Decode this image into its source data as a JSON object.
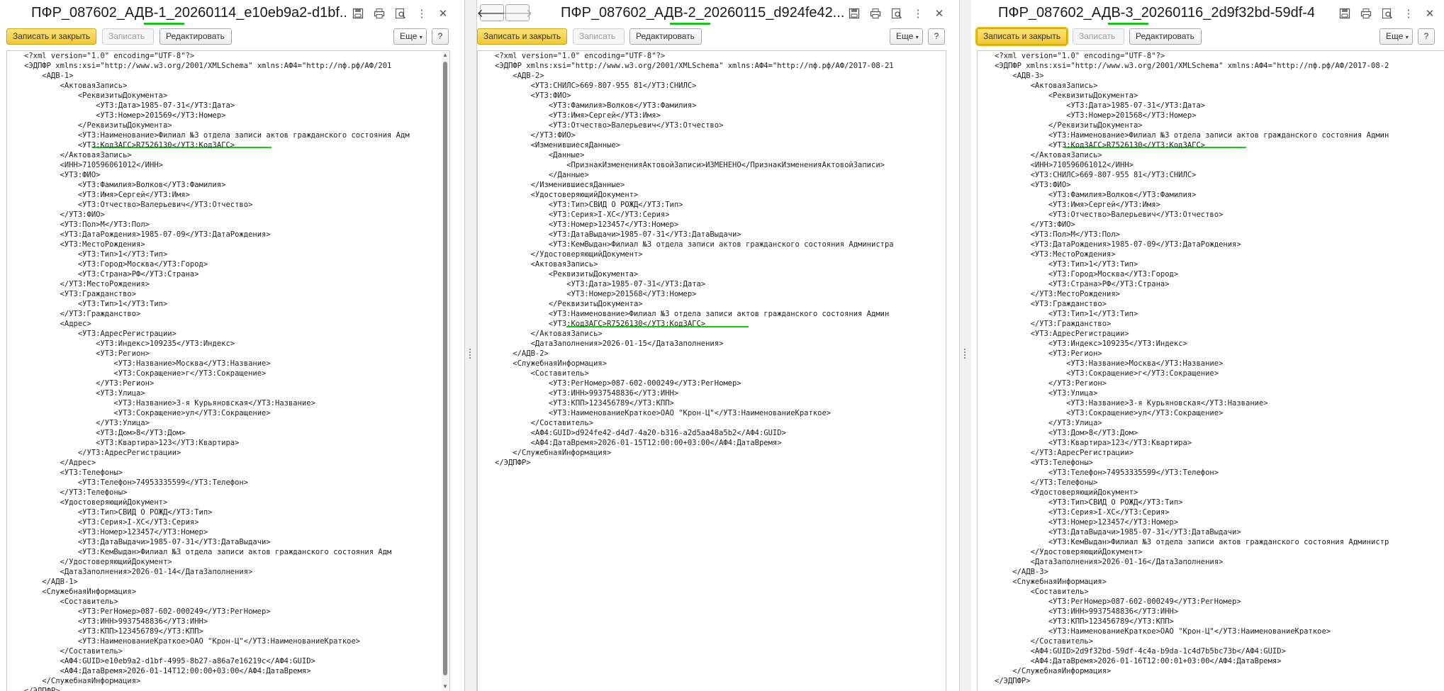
{
  "icons": {
    "save": "save-disk-icon",
    "print": "printer-icon",
    "preview": "preview-icon",
    "more": "more-vertical-icon",
    "close": "close-icon",
    "back": "back-arrow-icon",
    "forward": "forward-arrow-icon"
  },
  "colors": {
    "accent_underline": "#1ec21e",
    "primary_button": "#f2c830"
  },
  "toolbar": {
    "write_close": "Записать и закрыть",
    "write": "Записать",
    "edit": "Редактировать",
    "more": "Еще",
    "help": "?"
  },
  "panels": [
    {
      "title": "ПФР_087602_АДВ-1_20260114_e10eb9a2-d1bf...",
      "lines": [
        "<?xml version=\"1.0\" encoding=\"UTF-8\"?>",
        "<ЭДПФР xmlns:xsi=\"http://www.w3.org/2001/XMLSchema\" xmlns:АФ4=\"http://пф.рф/АФ/201",
        "    <АДВ-1>",
        "        <АктоваяЗапись>",
        "            <РеквизитыДокумента>",
        "                <УТ3:Дата>1985-07-31</УТ3:Дата>",
        "                <УТ3:Номер>201569</УТ3:Номер>",
        "            </РеквизитыДокумента>",
        "            <УТ3:Наименование>Филиал №3 отдела записи актов гражданского состояния Адм",
        "            <УТ3:КодЗАГС>R7526130</УТ3:КодЗАГС>",
        "        </АктоваяЗапись>",
        "        <ИНН>710596061012</ИНН>",
        "        <УТ3:ФИО>",
        "            <УТ3:Фамилия>Волков</УТ3:Фамилия>",
        "            <УТ3:Имя>Сергей</УТ3:Имя>",
        "            <УТ3:Отчество>Валерьевич</УТ3:Отчество>",
        "        </УТ3:ФИО>",
        "        <УТ3:Пол>М</УТ3:Пол>",
        "        <УТ3:ДатаРождения>1985-07-09</УТ3:ДатаРождения>",
        "        <УТ3:МестоРождения>",
        "            <УТ3:Тип>1</УТ3:Тип>",
        "            <УТ3:Город>Москва</УТ3:Город>",
        "            <УТ3:Страна>РФ</УТ3:Страна>",
        "        </УТ3:МестоРождения>",
        "        <УТ3:Гражданство>",
        "            <УТ3:Тип>1</УТ3:Тип>",
        "        </УТ3:Гражданство>",
        "        <Адрес>",
        "            <УТ3:АдресРегистрации>",
        "                <УТ3:Индекс>109235</УТ3:Индекс>",
        "                <УТ3:Регион>",
        "                    <УТ3:Название>Москва</УТ3:Название>",
        "                    <УТ3:Сокращение>г</УТ3:Сокращение>",
        "                </УТ3:Регион>",
        "                <УТ3:Улица>",
        "                    <УТ3:Название>3-я Курьяновская</УТ3:Название>",
        "                    <УТ3:Сокращение>ул</УТ3:Сокращение>",
        "                </УТ3:Улица>",
        "                <УТ3:Дом>8</УТ3:Дом>",
        "                <УТ3:Квартира>123</УТ3:Квартира>",
        "            </УТ3:АдресРегистрации>",
        "        </Адрес>",
        "        <УТ3:Телефоны>",
        "            <УТ3:Телефон>74953335599</УТ3:Телефон>",
        "        </УТ3:Телефоны>",
        "        <УдостоверяющийДокумент>",
        "            <УТ3:Тип>СВИД О РОЖД</УТ3:Тип>",
        "            <УТ3:Серия>I-ХС</УТ3:Серия>",
        "            <УТ3:Номер>123457</УТ3:Номер>",
        "            <УТ3:ДатаВыдачи>1985-07-31</УТ3:ДатаВыдачи>",
        "            <УТ3:КемВыдан>Филиал №3 отдела записи актов гражданского состояния Адм",
        "        </УдостоверяющийДокумент>",
        "        <ДатаЗаполнения>2026-01-14</ДатаЗаполнения>",
        "    </АДВ-1>",
        "    <СлужебнаяИнформация>",
        "        <Составитель>",
        "            <УТ3:РегНомер>087-602-000249</УТ3:РегНомер>",
        "            <УТ3:ИНН>9937548836</УТ3:ИНН>",
        "            <УТ3:КПП>123456789</УТ3:КПП>",
        "            <УТ3:НаименованиеКраткое>ОАО \"Крон-Ц\"</УТ3:НаименованиеКраткое>",
        "        </Составитель>",
        "        <АФ4:GUID>e10eb9a2-d1bf-4995-8b27-a86a7e16219c</АФ4:GUID>",
        "        <АФ4:ДатаВремя>2026-01-14T12:00:00+03:00</АФ4:ДатаВремя>",
        "    </СлужебнаяИнформация>",
        "</ЭДПФР>"
      ]
    },
    {
      "title": "ПФР_087602_АДВ-2_20260115_d924fe42...",
      "lines": [
        "<?xml version=\"1.0\" encoding=\"UTF-8\"?>",
        "<ЭДПФР xmlns:xsi=\"http://www.w3.org/2001/XMLSchema\" xmlns:АФ4=\"http://пф.рф/АФ/2017-08-21",
        "    <АДВ-2>",
        "        <УТ3:СНИЛС>669-807-955 81</УТ3:СНИЛС>",
        "        <УТ3:ФИО>",
        "            <УТ3:Фамилия>Волков</УТ3:Фамилия>",
        "            <УТ3:Имя>Сергей</УТ3:Имя>",
        "            <УТ3:Отчество>Валерьевич</УТ3:Отчество>",
        "        </УТ3:ФИО>",
        "        <ИзменившиесяДанные>",
        "            <Данные>",
        "                <ПризнакИзмененияАктовойЗаписи>ИЗМЕНЕНО</ПризнакИзмененияАктовойЗаписи>",
        "            </Данные>",
        "        </ИзменившиесяДанные>",
        "        <УдостоверяющийДокумент>",
        "            <УТ3:Тип>СВИД О РОЖД</УТ3:Тип>",
        "            <УТ3:Серия>I-ХС</УТ3:Серия>",
        "            <УТ3:Номер>123457</УТ3:Номер>",
        "            <УТ3:ДатаВыдачи>1985-07-31</УТ3:ДатаВыдачи>",
        "            <УТ3:КемВыдан>Филиал №3 отдела записи актов гражданского состояния Администра",
        "        </УдостоверяющийДокумент>",
        "        <АктоваяЗапись>",
        "            <РеквизитыДокумента>",
        "                <УТ3:Дата>1985-07-31</УТ3:Дата>",
        "                <УТ3:Номер>201568</УТ3:Номер>",
        "            </РеквизитыДокумента>",
        "            <УТ3:Наименование>Филиал №3 отдела записи актов гражданского состояния Админ",
        "            <УТ3:КодЗАГС>R7526130</УТ3:КодЗАГС>",
        "        </АктоваяЗапись>",
        "        <ДатаЗаполнения>2026-01-15</ДатаЗаполнения>",
        "    </АДВ-2>",
        "    <СлужебнаяИнформация>",
        "        <Составитель>",
        "            <УТ3:РегНомер>087-602-000249</УТ3:РегНомер>",
        "            <УТ3:ИНН>9937548836</УТ3:ИНН>",
        "            <УТ3:КПП>123456789</УТ3:КПП>",
        "            <УТ3:НаименованиеКраткое>ОАО \"Крон-Ц\"</УТ3:НаименованиеКраткое>",
        "        </Составитель>",
        "        <АФ4:GUID>d924fe42-d4d7-4a20-b316-a2d5aa48a5b2</АФ4:GUID>",
        "        <АФ4:ДатаВремя>2026-01-15T12:00:00+03:00</АФ4:ДатаВремя>",
        "    </СлужебнаяИнформация>",
        "</ЭДПФР>"
      ]
    },
    {
      "title": "ПФР_087602_АДВ-3_20260116_2d9f32bd-59df-4c...",
      "lines": [
        "<?xml version=\"1.0\" encoding=\"UTF-8\"?>",
        "<ЭДПФР xmlns:xsi=\"http://www.w3.org/2001/XMLSchema\" xmlns:АФ4=\"http://пф.рф/АФ/2017-08-2",
        "    <АДВ-3>",
        "        <АктоваяЗапись>",
        "            <РеквизитыДокумента>",
        "                <УТ3:Дата>1985-07-31</УТ3:Дата>",
        "                <УТ3:Номер>201568</УТ3:Номер>",
        "            </РеквизитыДокумента>",
        "            <УТ3:Наименование>Филиал №3 отдела записи актов гражданского состояния Админ",
        "            <УТ3:КодЗАГС>R7526130</УТ3:КодЗАГС>",
        "        </АктоваяЗапись>",
        "        <ИНН>710596061012</ИНН>",
        "        <УТ3:СНИЛС>669-807-955 81</УТ3:СНИЛС>",
        "        <УТ3:ФИО>",
        "            <УТ3:Фамилия>Волков</УТ3:Фамилия>",
        "            <УТ3:Имя>Сергей</УТ3:Имя>",
        "            <УТ3:Отчество>Валерьевич</УТ3:Отчество>",
        "        </УТ3:ФИО>",
        "        <УТ3:Пол>М</УТ3:Пол>",
        "        <УТ3:ДатаРождения>1985-07-09</УТ3:ДатаРождения>",
        "        <УТ3:МестоРождения>",
        "            <УТ3:Тип>1</УТ3:Тип>",
        "            <УТ3:Город>Москва</УТ3:Город>",
        "            <УТ3:Страна>РФ</УТ3:Страна>",
        "        </УТ3:МестоРождения>",
        "        <УТ3:Гражданство>",
        "            <УТ3:Тип>1</УТ3:Тип>",
        "        </УТ3:Гражданство>",
        "        <УТ3:АдресРегистрации>",
        "            <УТ3:Индекс>109235</УТ3:Индекс>",
        "            <УТ3:Регион>",
        "                <УТ3:Название>Москва</УТ3:Название>",
        "                <УТ3:Сокращение>г</УТ3:Сокращение>",
        "            </УТ3:Регион>",
        "            <УТ3:Улица>",
        "                <УТ3:Название>3-я Курьяновская</УТ3:Название>",
        "                <УТ3:Сокращение>ул</УТ3:Сокращение>",
        "            </УТ3:Улица>",
        "            <УТ3:Дом>8</УТ3:Дом>",
        "            <УТ3:Квартира>123</УТ3:Квартира>",
        "        </УТ3:АдресРегистрации>",
        "        <УТ3:Телефоны>",
        "            <УТ3:Телефон>74953335599</УТ3:Телефон>",
        "        </УТ3:Телефоны>",
        "        <УдостоверяющийДокумент>",
        "            <УТ3:Тип>СВИД О РОЖД</УТ3:Тип>",
        "            <УТ3:Серия>I-ХС</УТ3:Серия>",
        "            <УТ3:Номер>123457</УТ3:Номер>",
        "            <УТ3:ДатаВыдачи>1985-07-31</УТ3:ДатаВыдачи>",
        "            <УТ3:КемВыдан>Филиал №3 отдела записи актов гражданского состояния Администр",
        "        </УдостоверяющийДокумент>",
        "        <ДатаЗаполнения>2026-01-16</ДатаЗаполнения>",
        "    </АДВ-3>",
        "    <СлужебнаяИнформация>",
        "        <Составитель>",
        "            <УТ3:РегНомер>087-602-000249</УТ3:РегНомер>",
        "            <УТ3:ИНН>9937548836</УТ3:ИНН>",
        "            <УТ3:КПП>123456789</УТ3:КПП>",
        "            <УТ3:НаименованиеКраткое>ОАО \"Крон-Ц\"</УТ3:НаименованиеКраткое>",
        "        </Составитель>",
        "        <АФ4:GUID>2d9f32bd-59df-4c4a-b9da-1c4d7b5bc73b</АФ4:GUID>",
        "        <АФ4:ДатаВремя>2026-01-16T12:00:01+03:00</АФ4:ДатаВремя>",
        "    </СлужебнаяИнформация>",
        "</ЭДПФР>"
      ]
    }
  ]
}
